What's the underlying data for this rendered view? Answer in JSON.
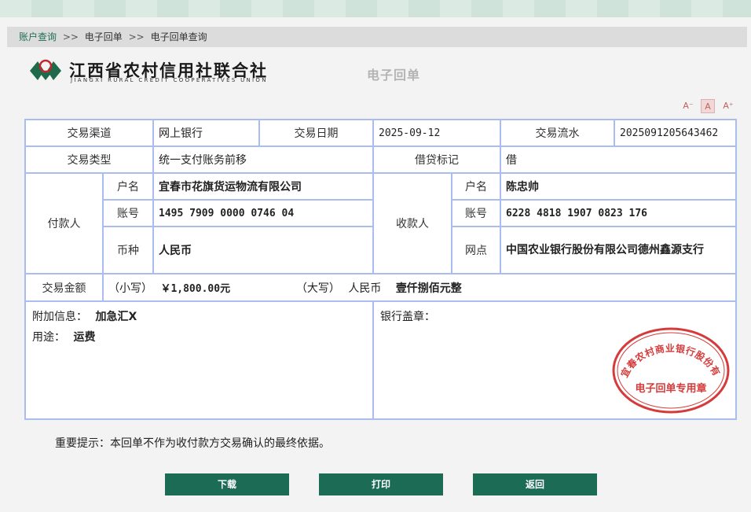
{
  "breadcrumb": {
    "items": [
      "账户查询",
      "电子回单",
      "电子回单查询"
    ],
    "separator": ">>"
  },
  "logo": {
    "title": "江西省农村信用社联合社",
    "subtitle": "JIANGXI RURAL CREDIT COOPERATIVES UNION"
  },
  "document_title": "电子回单",
  "font_controls": {
    "smaller": "A⁻",
    "normal": "A",
    "larger": "A⁺"
  },
  "receipt": {
    "channel_label": "交易渠道",
    "channel": "网上银行",
    "date_label": "交易日期",
    "date": "2025-09-12",
    "serial_label": "交易流水",
    "serial": "2025091205643462",
    "type_label": "交易类型",
    "type": "统一支付账务前移",
    "dc_label": "借贷标记",
    "dc": "借",
    "payer_label": "付款人",
    "payer": {
      "name_label": "户名",
      "name": "宜春市花旗货运物流有限公司",
      "account_label": "账号",
      "account": "1495 7909 0000 0746 04",
      "currency_label": "币种",
      "currency": "人民币"
    },
    "payee_label": "收款人",
    "payee": {
      "name_label": "户名",
      "name": "陈忠帅",
      "account_label": "账号",
      "account": "6228 4818 1907 0823 176",
      "branch_label": "网点",
      "branch": "中国农业银行股份有限公司德州鑫源支行"
    },
    "amount_label": "交易金额",
    "amount_small_label": "（小写）",
    "amount_small": "￥1,800.00元",
    "amount_big_label": "（大写）",
    "amount_currency": "人民币",
    "amount_big": "壹仟捌佰元整",
    "extra_label": "附加信息：",
    "extra": "加急汇X",
    "purpose_label": "用途：",
    "purpose": "运费",
    "stamp_label": "银行盖章："
  },
  "seal": {
    "arc_text": "宜春农村商业银行股份有限公司",
    "center_text": "电子回单专用章",
    "color": "#d63b3b"
  },
  "notice": "重要提示：本回单不作为收付款方交易确认的最终依据。",
  "buttons": {
    "download": "下载",
    "print": "打印",
    "back": "返回"
  },
  "colors": {
    "accent": "#1b6b55",
    "table_border": "#a9bdf0"
  }
}
